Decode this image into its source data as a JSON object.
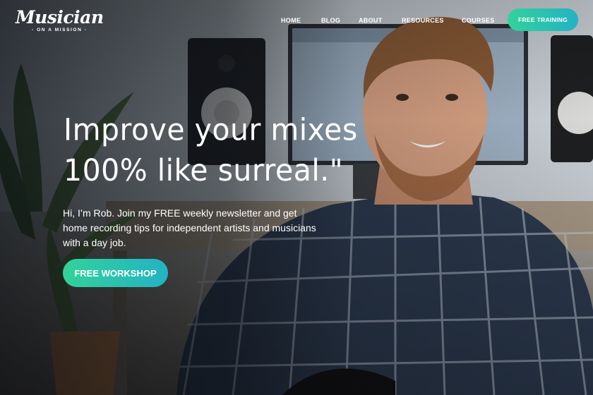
{
  "logo": {
    "brand": "Musician",
    "tagline": "- ON A MISSION -"
  },
  "nav": {
    "items": [
      "HOME",
      "BLOG",
      "ABOUT",
      "RESOURCES",
      "COURSES"
    ],
    "cta": "FREE TRAINING"
  },
  "hero": {
    "headline_line1": "Improve your mixes",
    "headline_line2": "100% like surreal.\"",
    "subtext": "Hi, I’m Rob. Join my FREE weekly newsletter and get home recording tips for independent artists and musicians with a day job.",
    "cta": "FREE WORKSHOP"
  },
  "colors": {
    "accent_start": "#33d29a",
    "accent_end": "#23b2c4",
    "text": "#ffffff"
  }
}
